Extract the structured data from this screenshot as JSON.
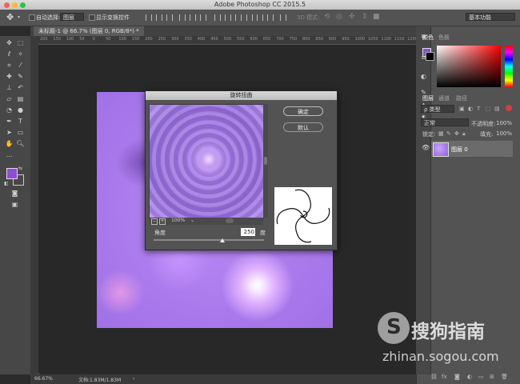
{
  "window": {
    "title": "Adobe Photoshop CC 2015.5"
  },
  "options_bar": {
    "auto_select_label": "自动选择:",
    "auto_select_value": "图层",
    "show_transform_label": "显示变换控件",
    "mode_3d_label": "3D 模式:",
    "workspace": "基本功能"
  },
  "document_tab": {
    "label": "未标题-1 @ 66.7% (图层 0, RGB/8*) *"
  },
  "ruler": {
    "ticks": [
      "200",
      "150",
      "100",
      "50",
      "0",
      "50",
      "100",
      "150",
      "200",
      "250",
      "300",
      "350",
      "400",
      "450",
      "500",
      "550",
      "600",
      "650",
      "700",
      "750",
      "800",
      "850",
      "900",
      "950",
      "1000",
      "1050",
      "1100",
      "1150",
      "1200"
    ]
  },
  "status": {
    "zoom": "66.67%",
    "doc_info": "文档:1.83M/1.83M"
  },
  "dialog": {
    "title": "旋转扭曲",
    "ok_label": "确定",
    "default_label": "默认",
    "zoom_value": "100%",
    "angle_label": "角度",
    "angle_value": "250",
    "angle_unit": "度",
    "angle_fraction": 0.625
  },
  "panels": {
    "color_tab": "颜色",
    "swatches_tab": "色板",
    "layers_tab": "图层",
    "channels_tab": "通道",
    "paths_tab": "路径",
    "kind_filter": "ρ 类型",
    "blend_mode": "正常",
    "opacity_label": "不透明度:",
    "opacity_value": "100%",
    "lock_label": "锁定:",
    "fill_label": "填充:",
    "fill_value": "100%",
    "layer_name": "图层 0"
  },
  "colors": {
    "foreground": "#8c4fd0",
    "background": "#000000",
    "accent": "#d04040"
  },
  "watermark": {
    "brand": "搜狗指南",
    "url": "zhinan.sogou.com"
  }
}
